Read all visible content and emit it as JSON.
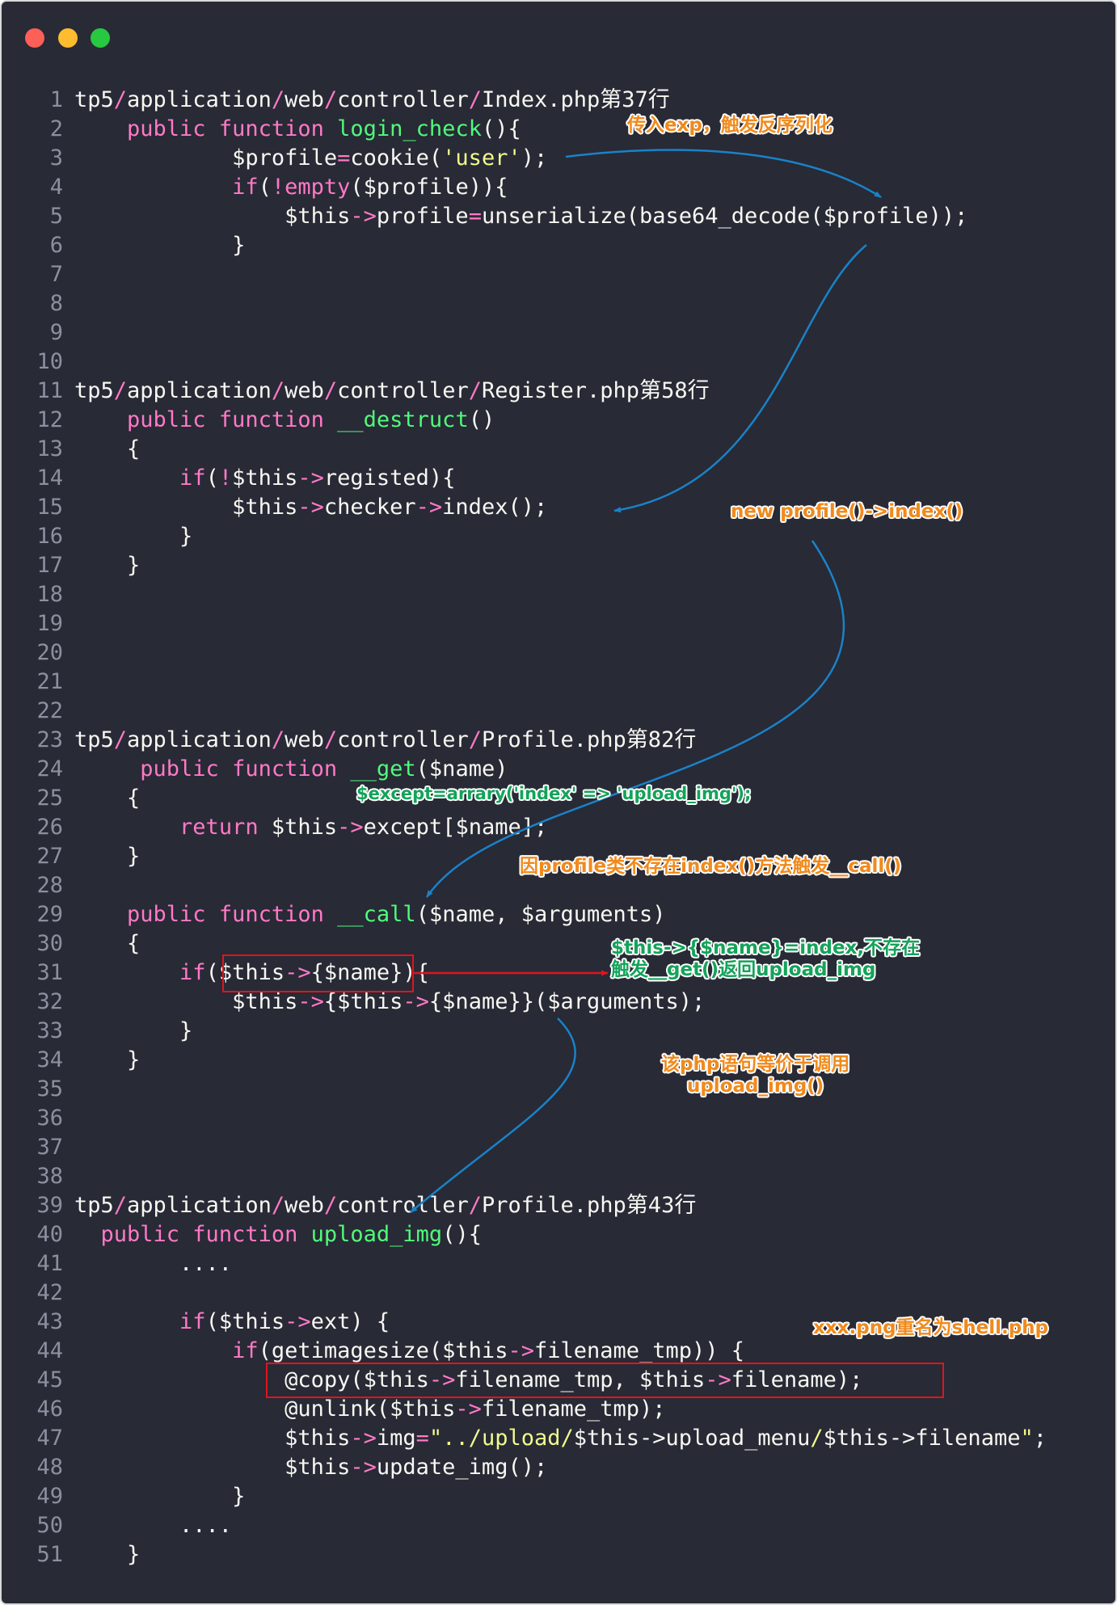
{
  "window": {
    "controls": [
      "close",
      "minimize",
      "maximize"
    ]
  },
  "code_lines": [
    [
      {
        "t": "tp5"
      },
      {
        "t": "/",
        "c": "k"
      },
      {
        "t": "application"
      },
      {
        "t": "/",
        "c": "k"
      },
      {
        "t": "web"
      },
      {
        "t": "/",
        "c": "k"
      },
      {
        "t": "controller"
      },
      {
        "t": "/",
        "c": "k"
      },
      {
        "t": "Index.php第37行"
      }
    ],
    [
      {
        "t": "    "
      },
      {
        "t": "public function",
        "c": "k"
      },
      {
        "t": " "
      },
      {
        "t": "login_check",
        "c": "f"
      },
      {
        "t": "(){"
      }
    ],
    [
      {
        "t": "            $profile"
      },
      {
        "t": "=",
        "c": "k"
      },
      {
        "t": "cookie("
      },
      {
        "t": "'user'",
        "c": "s"
      },
      {
        "t": ");"
      }
    ],
    [
      {
        "t": "            "
      },
      {
        "t": "if",
        "c": "k"
      },
      {
        "t": "("
      },
      {
        "t": "!empty",
        "c": "k"
      },
      {
        "t": "($profile)){"
      }
    ],
    [
      {
        "t": "                $this"
      },
      {
        "t": "->",
        "c": "k"
      },
      {
        "t": "profile"
      },
      {
        "t": "=",
        "c": "k"
      },
      {
        "t": "unserialize(base64_decode($profile));"
      }
    ],
    [
      {
        "t": "            }"
      }
    ],
    [],
    [],
    [],
    [],
    [
      {
        "t": "tp5"
      },
      {
        "t": "/",
        "c": "k"
      },
      {
        "t": "application"
      },
      {
        "t": "/",
        "c": "k"
      },
      {
        "t": "web"
      },
      {
        "t": "/",
        "c": "k"
      },
      {
        "t": "controller"
      },
      {
        "t": "/",
        "c": "k"
      },
      {
        "t": "Register.php第58行"
      }
    ],
    [
      {
        "t": "    "
      },
      {
        "t": "public function",
        "c": "k"
      },
      {
        "t": " "
      },
      {
        "t": "__destruct",
        "c": "f"
      },
      {
        "t": "()"
      }
    ],
    [
      {
        "t": "    {"
      }
    ],
    [
      {
        "t": "        "
      },
      {
        "t": "if",
        "c": "k"
      },
      {
        "t": "("
      },
      {
        "t": "!",
        "c": "k"
      },
      {
        "t": "$this"
      },
      {
        "t": "->",
        "c": "k"
      },
      {
        "t": "registed){"
      }
    ],
    [
      {
        "t": "            $this"
      },
      {
        "t": "->",
        "c": "k"
      },
      {
        "t": "checker"
      },
      {
        "t": "->",
        "c": "k"
      },
      {
        "t": "index();"
      }
    ],
    [
      {
        "t": "        }"
      }
    ],
    [
      {
        "t": "    }"
      }
    ],
    [],
    [],
    [],
    [],
    [],
    [
      {
        "t": "tp5"
      },
      {
        "t": "/",
        "c": "k"
      },
      {
        "t": "application"
      },
      {
        "t": "/",
        "c": "k"
      },
      {
        "t": "web"
      },
      {
        "t": "/",
        "c": "k"
      },
      {
        "t": "controller"
      },
      {
        "t": "/",
        "c": "k"
      },
      {
        "t": "Profile.php第82行"
      }
    ],
    [
      {
        "t": "     "
      },
      {
        "t": "public function",
        "c": "k"
      },
      {
        "t": " "
      },
      {
        "t": "__get",
        "c": "f"
      },
      {
        "t": "($name)"
      }
    ],
    [
      {
        "t": "    {"
      }
    ],
    [
      {
        "t": "        "
      },
      {
        "t": "return",
        "c": "k"
      },
      {
        "t": " $this"
      },
      {
        "t": "->",
        "c": "k"
      },
      {
        "t": "except[$name];"
      }
    ],
    [
      {
        "t": "    }"
      }
    ],
    [],
    [
      {
        "t": "    "
      },
      {
        "t": "public function",
        "c": "k"
      },
      {
        "t": " "
      },
      {
        "t": "__call",
        "c": "f"
      },
      {
        "t": "($name, $arguments)"
      }
    ],
    [
      {
        "t": "    {"
      }
    ],
    [
      {
        "t": "        "
      },
      {
        "t": "if",
        "c": "k"
      },
      {
        "t": "($this"
      },
      {
        "t": "->",
        "c": "k"
      },
      {
        "t": "{$name}){"
      }
    ],
    [
      {
        "t": "            $this"
      },
      {
        "t": "->",
        "c": "k"
      },
      {
        "t": "{$this"
      },
      {
        "t": "->",
        "c": "k"
      },
      {
        "t": "{$name}}($arguments);"
      }
    ],
    [
      {
        "t": "        }"
      }
    ],
    [
      {
        "t": "    }"
      }
    ],
    [],
    [],
    [],
    [],
    [
      {
        "t": "tp5"
      },
      {
        "t": "/",
        "c": "k"
      },
      {
        "t": "application"
      },
      {
        "t": "/",
        "c": "k"
      },
      {
        "t": "web"
      },
      {
        "t": "/",
        "c": "k"
      },
      {
        "t": "controller"
      },
      {
        "t": "/",
        "c": "k"
      },
      {
        "t": "Profile.php第43行"
      }
    ],
    [
      {
        "t": "  "
      },
      {
        "t": "public function",
        "c": "k"
      },
      {
        "t": " "
      },
      {
        "t": "upload_img",
        "c": "f"
      },
      {
        "t": "(){"
      }
    ],
    [
      {
        "t": "        ...."
      }
    ],
    [],
    [
      {
        "t": "        "
      },
      {
        "t": "if",
        "c": "k"
      },
      {
        "t": "($this"
      },
      {
        "t": "->",
        "c": "k"
      },
      {
        "t": "ext) {"
      }
    ],
    [
      {
        "t": "            "
      },
      {
        "t": "if",
        "c": "k"
      },
      {
        "t": "(getimagesize($this"
      },
      {
        "t": "->",
        "c": "k"
      },
      {
        "t": "filename_tmp)) {"
      }
    ],
    [
      {
        "t": "                @copy($this"
      },
      {
        "t": "->",
        "c": "k"
      },
      {
        "t": "filename_tmp, $this"
      },
      {
        "t": "->",
        "c": "k"
      },
      {
        "t": "filename);"
      }
    ],
    [
      {
        "t": "                @unlink($this"
      },
      {
        "t": "->",
        "c": "k"
      },
      {
        "t": "filename_tmp);"
      }
    ],
    [
      {
        "t": "                $this"
      },
      {
        "t": "->",
        "c": "k"
      },
      {
        "t": "img"
      },
      {
        "t": "=",
        "c": "k"
      },
      {
        "t": "\"../upload/",
        "c": "s"
      },
      {
        "t": "$this->upload_menu"
      },
      {
        "t": "/",
        "c": "s"
      },
      {
        "t": "$this->filename"
      },
      {
        "t": "\"",
        "c": "s"
      },
      {
        "t": ";"
      }
    ],
    [
      {
        "t": "                $this"
      },
      {
        "t": "->",
        "c": "k"
      },
      {
        "t": "update_img();"
      }
    ],
    [
      {
        "t": "            }"
      }
    ],
    [
      {
        "t": "        ...."
      }
    ],
    [
      {
        "t": "    }"
      }
    ]
  ],
  "annotations": {
    "exp_input": "传入exp，触发反序列化",
    "new_profile_index": "new profile()->index()",
    "except_array": "$except=arrary('index' => 'upload_img');",
    "trigger_call": "因profile类不存在index()方法触发__call()",
    "get_return": "$this->{$name}=index,不存在\n触发__get()返回upload_img",
    "equivalent_call": "该php语句等价于调用\nupload_img()",
    "rename_shell": "xxx.png重名为shell.php"
  },
  "colors": {
    "background": "#282a36",
    "keyword": "#ff79c6",
    "function": "#50fa7b",
    "string": "#f1fa8c",
    "line_number": "#8c8f9e",
    "arrow_blue": "#1a82c8",
    "arrow_red": "#e0141d",
    "annotation_orange": "#f08a1c",
    "annotation_green": "#14a35a"
  }
}
